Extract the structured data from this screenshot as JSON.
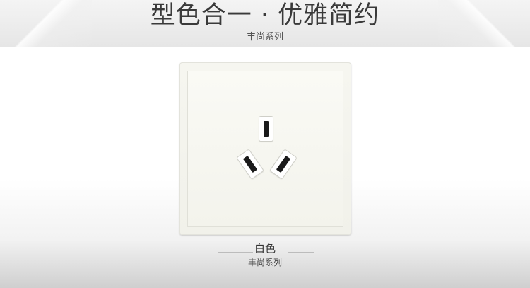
{
  "header": {
    "title": "型色合一 · 优雅简约",
    "subtitle": "丰尚系列"
  },
  "product": {
    "color_label": "白色",
    "series_label": "丰尚系列"
  }
}
